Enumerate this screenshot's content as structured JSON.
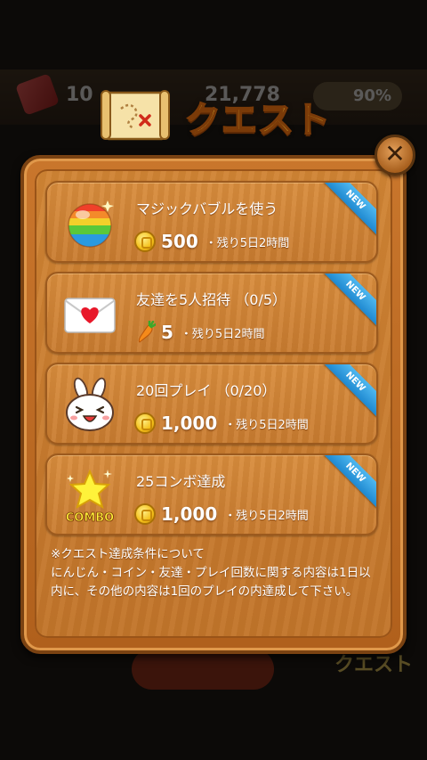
{
  "background": {
    "gem_count": "10",
    "coin_count": "21,778",
    "level_percent": "90%",
    "bottom_label": "クエスト"
  },
  "header": {
    "title": "クエスト",
    "icon": "treasure-map-scroll-icon"
  },
  "close_button": {
    "label": "✕"
  },
  "quests": [
    {
      "title": "マジックバブルを使う",
      "icon": "magic-bubble-icon",
      "reward_icon": "coin-icon",
      "reward_amount": "500",
      "remaining": "・残り5日2時間",
      "badge": "NEW"
    },
    {
      "title": "友達を5人招待 （0/5）",
      "icon": "heart-letter-icon",
      "reward_icon": "carrot-icon",
      "reward_amount": "5",
      "remaining": "・残り5日2時間",
      "badge": "NEW"
    },
    {
      "title": "20回プレイ （0/20）",
      "icon": "bunny-face-icon",
      "reward_icon": "coin-icon",
      "reward_amount": "1,000",
      "remaining": "・残り5日2時間",
      "badge": "NEW"
    },
    {
      "title": "25コンボ達成",
      "icon": "combo-star-icon",
      "icon_text": "COMBO",
      "reward_icon": "coin-icon",
      "reward_amount": "1,000",
      "remaining": "・残り5日2時間",
      "badge": "NEW"
    }
  ],
  "note": "※クエスト達成条件について\nにんじん・コイン・友達・プレイ回数に関する内容は1日以内に、その他の内容は1回のプレイの内達成して下さい。",
  "colors": {
    "title": "#fcd43a",
    "panel": "#c9762c",
    "ribbon": "#1e88d0"
  }
}
